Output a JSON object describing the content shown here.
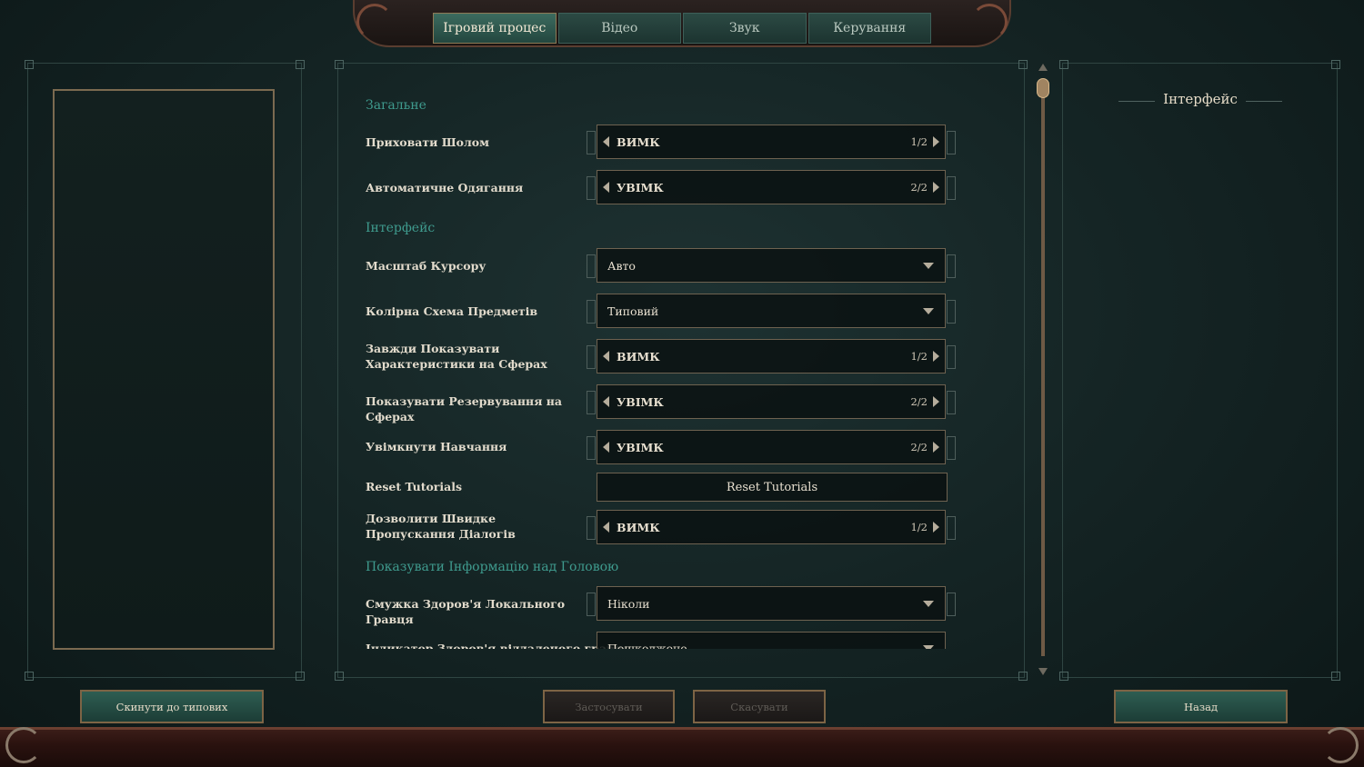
{
  "tabs": [
    {
      "label": "Ігровий процес",
      "active": true
    },
    {
      "label": "Відео",
      "active": false
    },
    {
      "label": "Звук",
      "active": false
    },
    {
      "label": "Керування",
      "active": false
    }
  ],
  "sections": {
    "general": "Загальне",
    "interface": "Інтерфейс",
    "overhead": "Показувати Інформацію над Головою"
  },
  "settings": {
    "hide_helmet": {
      "label": "Приховати Шолом",
      "value": "ВИМК",
      "count": "1/2"
    },
    "auto_equip": {
      "label": "Автоматичне Одягання",
      "value": "УВІМК",
      "count": "2/2"
    },
    "cursor_scale": {
      "label": "Масштаб Курсору",
      "value": "Авто"
    },
    "item_color": {
      "label": "Колірна Схема Предметів",
      "value": "Типовий"
    },
    "orb_stats": {
      "label": "Завжди Показувати Характеристики на Сферах",
      "value": "ВИМК",
      "count": "1/2"
    },
    "orb_reserve": {
      "label": "Показувати Резервування на Сферах",
      "value": "УВІМК",
      "count": "2/2"
    },
    "tutorials": {
      "label": "Увімкнути Навчання",
      "value": "УВІМК",
      "count": "2/2"
    },
    "reset_tutorials": {
      "label": "Reset Tutorials",
      "button": "Reset Tutorials"
    },
    "skip_dialog": {
      "label": "Дозволити Швидке Пропускання Діалогів",
      "value": "ВИМК",
      "count": "1/2"
    },
    "local_health": {
      "label": "Смужка Здоров'я Локального Гравця",
      "value": "Ніколи"
    },
    "other_health": {
      "label": "Індикатор Здоров'я віддаленого гравця",
      "value": "Пошкоджене"
    }
  },
  "right_panel": {
    "title": "Інтерфейс"
  },
  "buttons": {
    "reset_defaults": "Скинути до типових",
    "apply": "Застосувати",
    "cancel": "Скасувати",
    "back": "Назад"
  },
  "colors": {
    "accent_teal": "#3f9b8e",
    "background": "#152525",
    "frame_gold": "#7b6a50"
  }
}
